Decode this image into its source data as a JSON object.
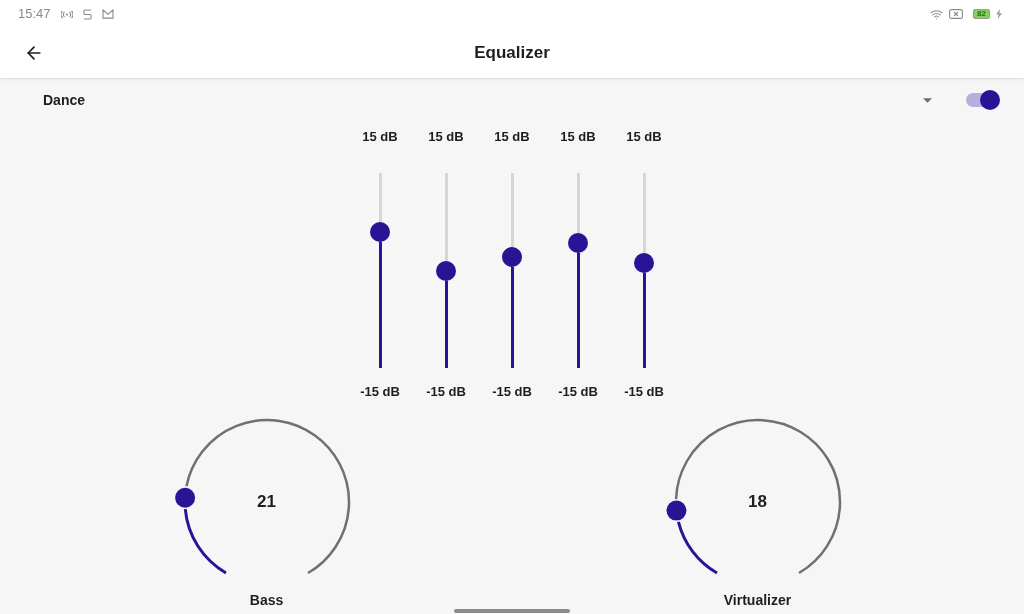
{
  "status_bar": {
    "time": "15:47",
    "battery": "82"
  },
  "app_bar": {
    "title": "Equalizer"
  },
  "preset": {
    "value": "Dance",
    "on": true
  },
  "bands": [
    {
      "max_label": "15 dB",
      "min_label": "-15 dB",
      "level": 0.7
    },
    {
      "max_label": "15 dB",
      "min_label": "-15 dB",
      "level": 0.5
    },
    {
      "max_label": "15 dB",
      "min_label": "-15 dB",
      "level": 0.57
    },
    {
      "max_label": "15 dB",
      "min_label": "-15 dB",
      "level": 0.64
    },
    {
      "max_label": "15 dB",
      "min_label": "-15 dB",
      "level": 0.54
    }
  ],
  "knobs": [
    {
      "value": "21",
      "label": "Bass",
      "level": 0.21
    },
    {
      "value": "18",
      "label": "Virtualizer",
      "level": 0.18
    }
  ]
}
